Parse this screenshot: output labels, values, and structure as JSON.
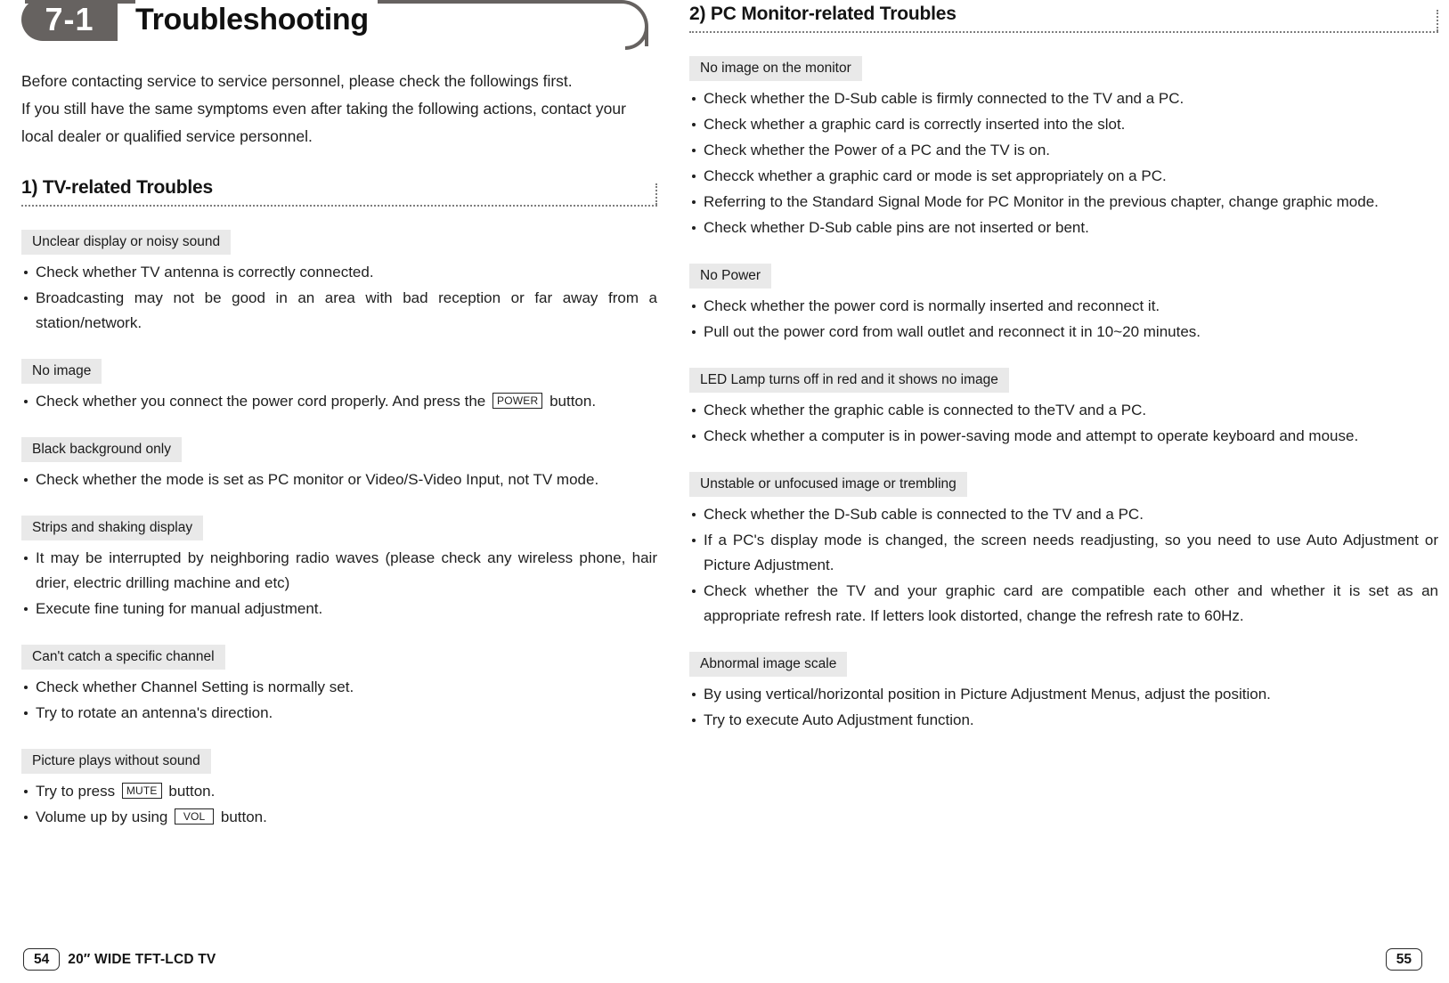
{
  "header": {
    "badge": "7-1",
    "title": "Troubleshooting"
  },
  "intro": {
    "line1": "Before contacting service to service personnel, please check the followings first.",
    "line2": "If you still have the same symptoms even after taking the following actions, contact your",
    "line3": "local dealer or qualified service personnel."
  },
  "sections": [
    {
      "heading": "1) TV-related Troubles",
      "blocks": [
        {
          "label": "Unclear display or noisy sound",
          "items": [
            "Check whether TV antenna is correctly connected.",
            "Broadcasting may not be good in an area with bad reception or far away from a station/network."
          ]
        },
        {
          "label": "No image",
          "items_rich": [
            {
              "pre": "Check whether you connect the power cord properly. And press the",
              "key": "POWER",
              "post": "button."
            }
          ]
        },
        {
          "label": "Black background only",
          "items": [
            "Check whether the mode is set as PC monitor or Video/S-Video Input, not TV mode."
          ]
        },
        {
          "label": "Strips and shaking display",
          "items": [
            "It may be interrupted by neighboring radio waves (please check any wireless phone, hair drier, electric drilling machine and etc)",
            "Execute fine tuning for manual adjustment."
          ]
        },
        {
          "label": "Can't catch a specific channel",
          "items": [
            "Check whether Channel Setting is normally set.",
            "Try to rotate an antenna's direction."
          ]
        },
        {
          "label": "Picture plays without sound",
          "items_rich": [
            {
              "pre": "Try to press",
              "key": "MUTE",
              "post": "button."
            },
            {
              "pre": "Volume up by using",
              "key": "VOL",
              "post": "button."
            }
          ]
        }
      ]
    },
    {
      "heading": "2) PC Monitor-related Troubles",
      "blocks": [
        {
          "label": "No image on the monitor",
          "items": [
            "Check whether the D-Sub cable is firmly connected to the TV and a PC.",
            "Check whether a graphic card is correctly inserted into the slot.",
            "Check whether the Power of a PC and the TV is on.",
            "Checck whether a graphic card or mode is set appropriately on a PC.",
            "Referring to the Standard Signal Mode for PC Monitor in the previous chapter, change graphic mode.",
            "Check whether D-Sub cable pins are not inserted or bent."
          ]
        },
        {
          "label": "No Power",
          "items": [
            "Check whether the power cord is normally inserted and reconnect it.",
            "Pull out the power cord from wall outlet and reconnect it in 10~20 minutes."
          ]
        },
        {
          "label": "LED Lamp turns off in red and it shows no image",
          "items": [
            "Check whether the graphic cable is connected to theTV and a PC.",
            "Check whether a computer is in power-saving mode and attempt to operate keyboard and mouse."
          ]
        },
        {
          "label": "Unstable or unfocused image or trembling",
          "items": [
            "Check whether the D-Sub cable is connected to the TV and a PC.",
            "If a PC's display mode is changed, the screen needs readjusting, so you need to use Auto Adjustment or Picture Adjustment.",
            "Check whether the TV and your graphic card are compatible each other and whether it is set as an appropriate refresh rate. If letters look distorted, change the refresh rate to 60Hz."
          ]
        },
        {
          "label": "Abnormal image scale",
          "items": [
            "By using vertical/horizontal position in Picture Adjustment Menus, adjust the position.",
            "Try to execute Auto Adjustment function."
          ]
        }
      ]
    }
  ],
  "footer": {
    "left_page": "54",
    "model": "20″ WIDE TFT-LCD TV",
    "right_page": "55"
  },
  "colors": {
    "badge_bg": "#666260",
    "chip_bg": "#e9e9e9",
    "text": "#1f1f1f",
    "rule": "#7d7d7d"
  }
}
